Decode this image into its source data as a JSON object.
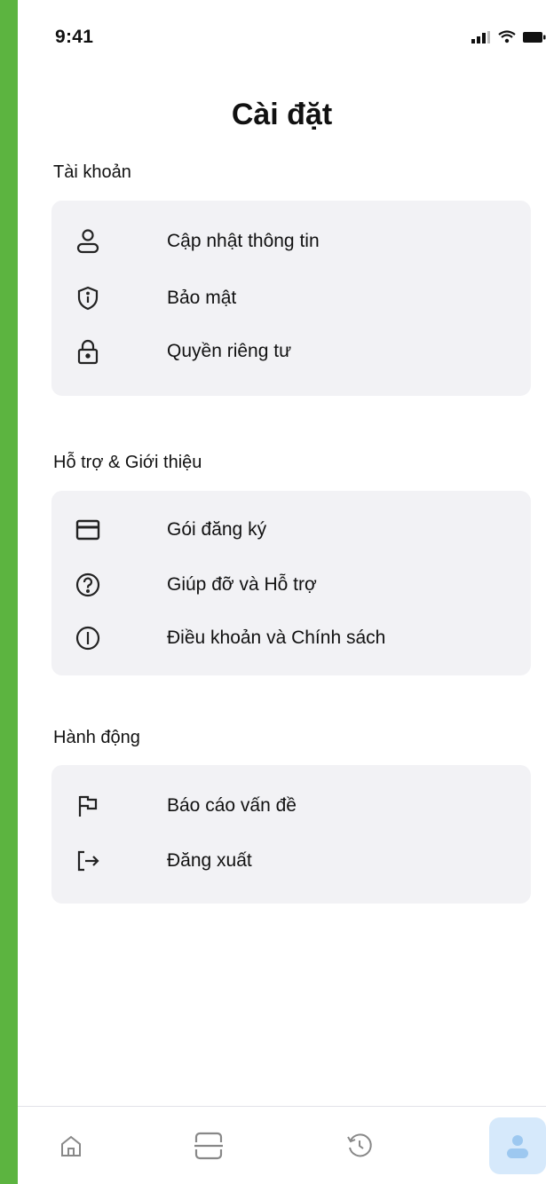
{
  "status_bar": {
    "time": "9:41"
  },
  "page_title": "Cài đặt",
  "sections": [
    {
      "title": "Tài khoản",
      "items": [
        {
          "label": "Cập nhật thông tin",
          "icon": "user-icon"
        },
        {
          "label": "Bảo mật",
          "icon": "shield-icon"
        },
        {
          "label": "Quyền riêng tư",
          "icon": "lock-icon"
        }
      ]
    },
    {
      "title": "Hỗ trợ & Giới thiệu",
      "items": [
        {
          "label": "Gói đăng ký",
          "icon": "credit-card-icon"
        },
        {
          "label": "Giúp đỡ và Hỗ trợ",
          "icon": "help-circle-icon"
        },
        {
          "label": "Điều khoản và Chính sách",
          "icon": "info-circle-icon"
        }
      ]
    },
    {
      "title": "Hành động",
      "items": [
        {
          "label": "Báo cáo vấn đề",
          "icon": "flag-icon"
        },
        {
          "label": "Đăng xuất",
          "icon": "logout-icon"
        }
      ]
    }
  ],
  "tab_bar": [
    {
      "icon": "home-icon",
      "active": false
    },
    {
      "icon": "scan-icon",
      "active": false
    },
    {
      "icon": "history-icon",
      "active": false
    },
    {
      "icon": "profile-icon",
      "active": true
    }
  ],
  "colors": {
    "background_frame": "#5cb440",
    "card": "#f2f2f5",
    "active_tab": "#d6e9fb",
    "active_icon": "#9dc8f0"
  }
}
